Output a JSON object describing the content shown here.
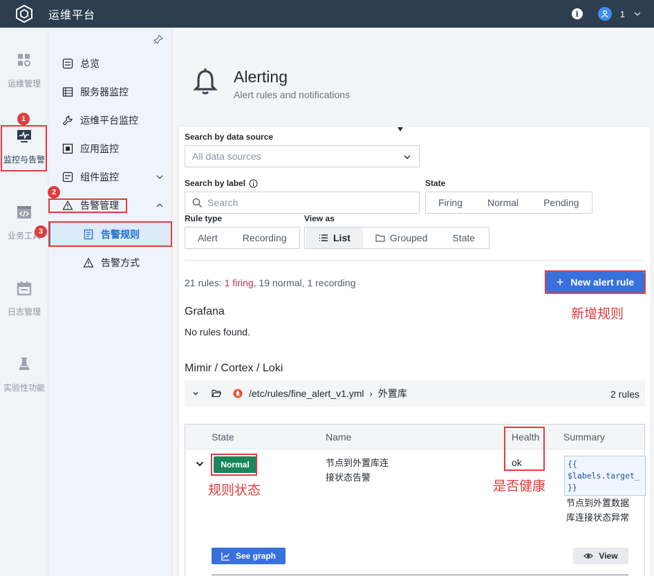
{
  "app": {
    "title": "运维平台",
    "user_num": "1"
  },
  "rail": [
    {
      "label": "运维管理",
      "icon": "grid-settings-icon"
    },
    {
      "label": "监控与告警",
      "icon": "monitor-icon"
    },
    {
      "label": "业务工具",
      "icon": "code-window-icon"
    },
    {
      "label": "日志管理",
      "icon": "calendar-icon"
    },
    {
      "label": "实验性功能",
      "icon": "flask-icon"
    }
  ],
  "subnav": {
    "items": [
      {
        "label": "总览",
        "icon": "overview-icon"
      },
      {
        "label": "服务器监控",
        "icon": "server-list-icon"
      },
      {
        "label": "运维平台监控",
        "icon": "wrench-icon"
      },
      {
        "label": "应用监控",
        "icon": "app-monitor-icon"
      },
      {
        "label": "组件监控",
        "icon": "component-icon"
      },
      {
        "label": "告警管理",
        "icon": "alert-triangle-icon"
      },
      {
        "label": "告警规则",
        "icon": "rules-doc-icon"
      },
      {
        "label": "告警方式",
        "icon": "alert-triangle-icon"
      }
    ]
  },
  "annotations": {
    "badges": [
      "1",
      "2",
      "3"
    ],
    "notes": {
      "new_rule": "新增规则",
      "rule_state": "规则状态",
      "health": "是否健康"
    }
  },
  "page": {
    "title": "Alerting",
    "subtitle": "Alert rules and notifications"
  },
  "filters": {
    "datasource_label": "Search by data source",
    "datasource_placeholder": "All data sources",
    "label_label": "Search by label",
    "label_placeholder": "Search",
    "state_label": "State",
    "state_options": [
      "Firing",
      "Normal",
      "Pending"
    ],
    "rule_type_label": "Rule type",
    "rule_type_options": [
      "Alert",
      "Recording"
    ],
    "view_as_label": "View as",
    "view_as_options": [
      "List",
      "Grouped",
      "State"
    ],
    "view_as_selected": "List"
  },
  "stats": {
    "prefix": "21 rules: ",
    "firing": "1 firing",
    "rest": ", 19 normal, 1 recording"
  },
  "new_rule_label": "New alert rule",
  "sections": {
    "grafana_title": "Grafana",
    "grafana_empty": "No rules found.",
    "mimir_title": "Mimir / Cortex / Loki"
  },
  "group": {
    "path": "/etc/rules/fine_alert_v1.yml",
    "name": "外置库",
    "count": "2 rules"
  },
  "table": {
    "headers": {
      "state": "State",
      "name": "Name",
      "health": "Health",
      "summary": "Summary"
    },
    "row": {
      "state": "Normal",
      "name_line1": "节点到外置库连",
      "name_line2": "接状态告警",
      "health": "ok",
      "summary_code": "{{\n$labels.target_\n}}",
      "summary_text1": "节点到外置数据",
      "summary_text2": "库连接状态异常"
    },
    "see_graph": "See graph",
    "view": "View"
  },
  "colors": {
    "topbar": "#2c3e50",
    "primary": "#3871dc",
    "normal_state": "#1b855e",
    "annotation": "#e23b3b",
    "firing": "#c4314b"
  }
}
